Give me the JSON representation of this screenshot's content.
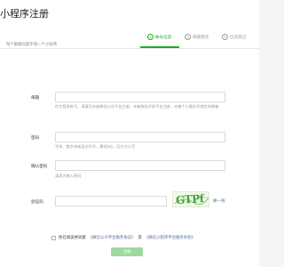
{
  "header": {
    "title": "小程序注册"
  },
  "steps": [
    {
      "num": "1",
      "label": "帐号信息",
      "active": true
    },
    {
      "num": "2",
      "label": "邮箱激活",
      "active": false
    },
    {
      "num": "3",
      "label": "信息登记",
      "active": false
    }
  ],
  "form": {
    "subtitle": "每个邮箱仅能申请一个小程序",
    "email": {
      "label": "邮箱",
      "value": "",
      "tip": "作为登录帐号，请填写未被微信公众平台注册，未被微信开放平台注册，未被个人微信号绑定的邮箱"
    },
    "password": {
      "label": "密码",
      "value": "",
      "tip": "字母、数字或者英文符号，最短8位，区分大小写"
    },
    "confirm_password": {
      "label": "确认密码",
      "value": "",
      "tip": "请再次输入密码"
    },
    "captcha": {
      "label": "验证码",
      "value": "",
      "image_text": "GTPf",
      "refresh": "换一张"
    },
    "agreement": {
      "prefix": "你已阅读并同意",
      "link1": "《微信公众平台服务协议》",
      "middle": "及",
      "link2": "《微信小程序平台服务条款》"
    },
    "submit_label": "注册"
  }
}
